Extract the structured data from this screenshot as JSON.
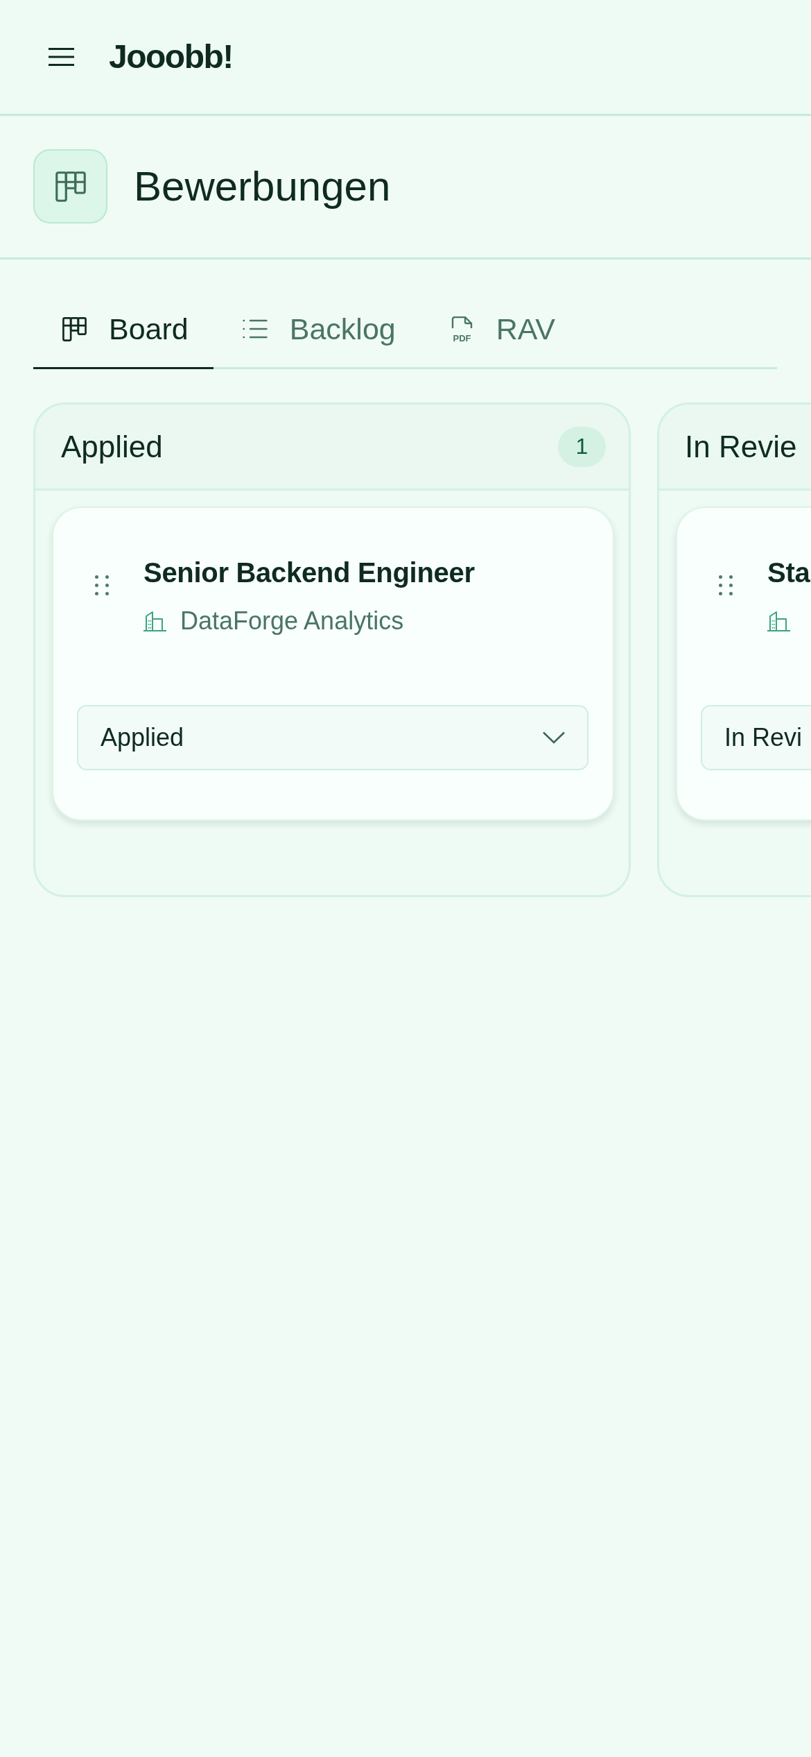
{
  "app_bar": {
    "logo": "Jooobb!"
  },
  "page_header": {
    "title": "Bewerbungen"
  },
  "tabs": [
    {
      "label": "Board",
      "selected": true
    },
    {
      "label": "Backlog",
      "selected": false
    },
    {
      "label": "RAV",
      "selected": false,
      "icon_text": "PDF"
    }
  ],
  "columns": [
    {
      "title": "Applied",
      "count": "1",
      "cards": [
        {
          "title": "Senior Backend Engineer",
          "company": "DataForge Analytics",
          "status": "Applied"
        }
      ]
    },
    {
      "title": "In Revie",
      "cards": [
        {
          "title": "Sta",
          "status": "In Revi"
        }
      ]
    }
  ]
}
